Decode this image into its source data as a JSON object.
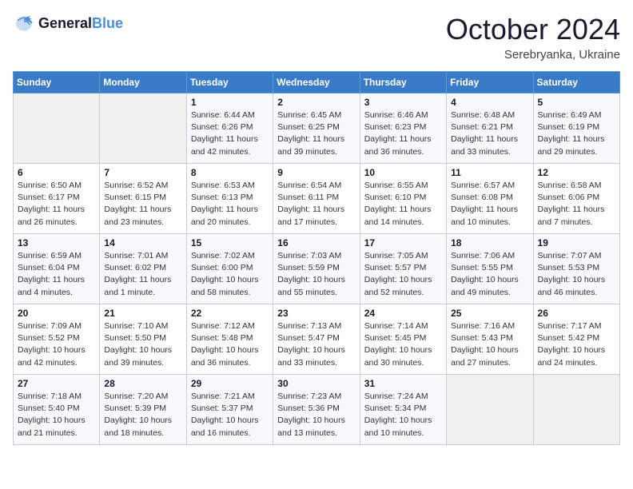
{
  "header": {
    "logo_line1": "General",
    "logo_line2": "Blue",
    "month": "October 2024",
    "location": "Serebryanka, Ukraine"
  },
  "weekdays": [
    "Sunday",
    "Monday",
    "Tuesday",
    "Wednesday",
    "Thursday",
    "Friday",
    "Saturday"
  ],
  "weeks": [
    [
      {
        "day": "",
        "info": ""
      },
      {
        "day": "",
        "info": ""
      },
      {
        "day": "1",
        "info": "Sunrise: 6:44 AM\nSunset: 6:26 PM\nDaylight: 11 hours and 42 minutes."
      },
      {
        "day": "2",
        "info": "Sunrise: 6:45 AM\nSunset: 6:25 PM\nDaylight: 11 hours and 39 minutes."
      },
      {
        "day": "3",
        "info": "Sunrise: 6:46 AM\nSunset: 6:23 PM\nDaylight: 11 hours and 36 minutes."
      },
      {
        "day": "4",
        "info": "Sunrise: 6:48 AM\nSunset: 6:21 PM\nDaylight: 11 hours and 33 minutes."
      },
      {
        "day": "5",
        "info": "Sunrise: 6:49 AM\nSunset: 6:19 PM\nDaylight: 11 hours and 29 minutes."
      }
    ],
    [
      {
        "day": "6",
        "info": "Sunrise: 6:50 AM\nSunset: 6:17 PM\nDaylight: 11 hours and 26 minutes."
      },
      {
        "day": "7",
        "info": "Sunrise: 6:52 AM\nSunset: 6:15 PM\nDaylight: 11 hours and 23 minutes."
      },
      {
        "day": "8",
        "info": "Sunrise: 6:53 AM\nSunset: 6:13 PM\nDaylight: 11 hours and 20 minutes."
      },
      {
        "day": "9",
        "info": "Sunrise: 6:54 AM\nSunset: 6:11 PM\nDaylight: 11 hours and 17 minutes."
      },
      {
        "day": "10",
        "info": "Sunrise: 6:55 AM\nSunset: 6:10 PM\nDaylight: 11 hours and 14 minutes."
      },
      {
        "day": "11",
        "info": "Sunrise: 6:57 AM\nSunset: 6:08 PM\nDaylight: 11 hours and 10 minutes."
      },
      {
        "day": "12",
        "info": "Sunrise: 6:58 AM\nSunset: 6:06 PM\nDaylight: 11 hours and 7 minutes."
      }
    ],
    [
      {
        "day": "13",
        "info": "Sunrise: 6:59 AM\nSunset: 6:04 PM\nDaylight: 11 hours and 4 minutes."
      },
      {
        "day": "14",
        "info": "Sunrise: 7:01 AM\nSunset: 6:02 PM\nDaylight: 11 hours and 1 minute."
      },
      {
        "day": "15",
        "info": "Sunrise: 7:02 AM\nSunset: 6:00 PM\nDaylight: 10 hours and 58 minutes."
      },
      {
        "day": "16",
        "info": "Sunrise: 7:03 AM\nSunset: 5:59 PM\nDaylight: 10 hours and 55 minutes."
      },
      {
        "day": "17",
        "info": "Sunrise: 7:05 AM\nSunset: 5:57 PM\nDaylight: 10 hours and 52 minutes."
      },
      {
        "day": "18",
        "info": "Sunrise: 7:06 AM\nSunset: 5:55 PM\nDaylight: 10 hours and 49 minutes."
      },
      {
        "day": "19",
        "info": "Sunrise: 7:07 AM\nSunset: 5:53 PM\nDaylight: 10 hours and 46 minutes."
      }
    ],
    [
      {
        "day": "20",
        "info": "Sunrise: 7:09 AM\nSunset: 5:52 PM\nDaylight: 10 hours and 42 minutes."
      },
      {
        "day": "21",
        "info": "Sunrise: 7:10 AM\nSunset: 5:50 PM\nDaylight: 10 hours and 39 minutes."
      },
      {
        "day": "22",
        "info": "Sunrise: 7:12 AM\nSunset: 5:48 PM\nDaylight: 10 hours and 36 minutes."
      },
      {
        "day": "23",
        "info": "Sunrise: 7:13 AM\nSunset: 5:47 PM\nDaylight: 10 hours and 33 minutes."
      },
      {
        "day": "24",
        "info": "Sunrise: 7:14 AM\nSunset: 5:45 PM\nDaylight: 10 hours and 30 minutes."
      },
      {
        "day": "25",
        "info": "Sunrise: 7:16 AM\nSunset: 5:43 PM\nDaylight: 10 hours and 27 minutes."
      },
      {
        "day": "26",
        "info": "Sunrise: 7:17 AM\nSunset: 5:42 PM\nDaylight: 10 hours and 24 minutes."
      }
    ],
    [
      {
        "day": "27",
        "info": "Sunrise: 7:18 AM\nSunset: 5:40 PM\nDaylight: 10 hours and 21 minutes."
      },
      {
        "day": "28",
        "info": "Sunrise: 7:20 AM\nSunset: 5:39 PM\nDaylight: 10 hours and 18 minutes."
      },
      {
        "day": "29",
        "info": "Sunrise: 7:21 AM\nSunset: 5:37 PM\nDaylight: 10 hours and 16 minutes."
      },
      {
        "day": "30",
        "info": "Sunrise: 7:23 AM\nSunset: 5:36 PM\nDaylight: 10 hours and 13 minutes."
      },
      {
        "day": "31",
        "info": "Sunrise: 7:24 AM\nSunset: 5:34 PM\nDaylight: 10 hours and 10 minutes."
      },
      {
        "day": "",
        "info": ""
      },
      {
        "day": "",
        "info": ""
      }
    ]
  ]
}
